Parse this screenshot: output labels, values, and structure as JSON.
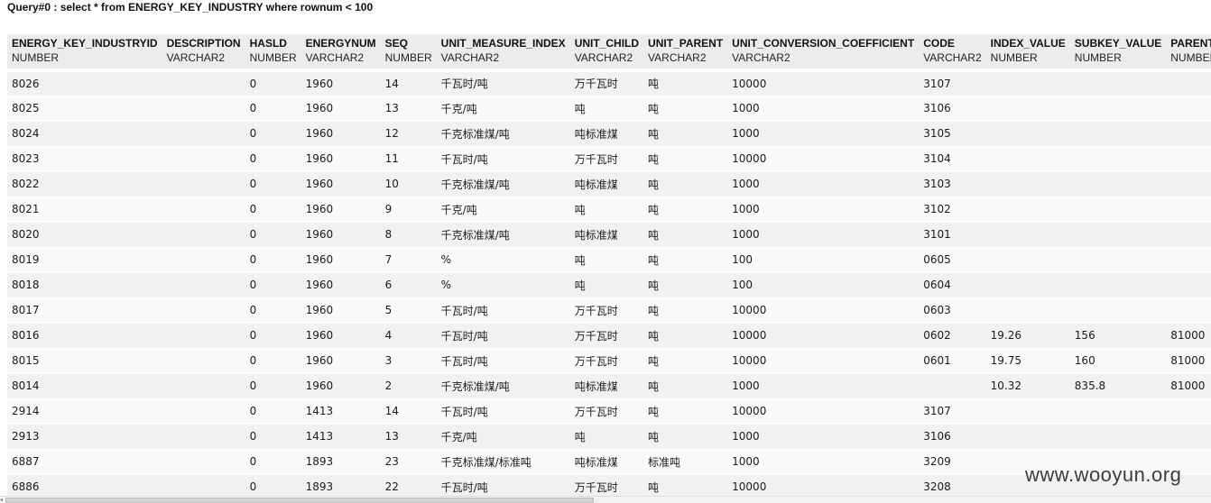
{
  "query_title": "Query#0 : select * from ENERGY_KEY_INDUSTRY where rownum < 100",
  "columns": [
    {
      "name": "ENERGY_KEY_INDUSTRYID",
      "type": "NUMBER"
    },
    {
      "name": "DESCRIPTION",
      "type": "VARCHAR2"
    },
    {
      "name": "HASLD",
      "type": "NUMBER"
    },
    {
      "name": "ENERGYNUM",
      "type": "VARCHAR2"
    },
    {
      "name": "SEQ",
      "type": "NUMBER"
    },
    {
      "name": "UNIT_MEASURE_INDEX",
      "type": "VARCHAR2"
    },
    {
      "name": "UNIT_CHILD",
      "type": "VARCHAR2"
    },
    {
      "name": "UNIT_PARENT",
      "type": "VARCHAR2"
    },
    {
      "name": "UNIT_CONVERSION_COEFFICIENT",
      "type": "VARCHAR2"
    },
    {
      "name": "CODE",
      "type": "VARCHAR2"
    },
    {
      "name": "INDEX_VALUE",
      "type": "NUMBER"
    },
    {
      "name": "SUBKEY_VALUE",
      "type": "NUMBER"
    },
    {
      "name": "PARENT_",
      "type": "NUMBER"
    }
  ],
  "rows": [
    [
      "8026",
      "",
      "0",
      "1960",
      "14",
      "千瓦时/吨",
      "万千瓦时",
      "吨",
      "10000",
      "3107",
      "",
      "",
      ""
    ],
    [
      "8025",
      "",
      "0",
      "1960",
      "13",
      "千克/吨",
      "吨",
      "吨",
      "1000",
      "3106",
      "",
      "",
      ""
    ],
    [
      "8024",
      "",
      "0",
      "1960",
      "12",
      "千克标准煤/吨",
      "吨标准煤",
      "吨",
      "1000",
      "3105",
      "",
      "",
      ""
    ],
    [
      "8023",
      "",
      "0",
      "1960",
      "11",
      "千瓦时/吨",
      "万千瓦时",
      "吨",
      "10000",
      "3104",
      "",
      "",
      ""
    ],
    [
      "8022",
      "",
      "0",
      "1960",
      "10",
      "千克标准煤/吨",
      "吨标准煤",
      "吨",
      "1000",
      "3103",
      "",
      "",
      ""
    ],
    [
      "8021",
      "",
      "0",
      "1960",
      "9",
      "千克/吨",
      "吨",
      "吨",
      "1000",
      "3102",
      "",
      "",
      ""
    ],
    [
      "8020",
      "",
      "0",
      "1960",
      "8",
      "千克标准煤/吨",
      "吨标准煤",
      "吨",
      "1000",
      "3101",
      "",
      "",
      ""
    ],
    [
      "8019",
      "",
      "0",
      "1960",
      "7",
      "%",
      "吨",
      "吨",
      "100",
      "0605",
      "",
      "",
      ""
    ],
    [
      "8018",
      "",
      "0",
      "1960",
      "6",
      "%",
      "吨",
      "吨",
      "100",
      "0604",
      "",
      "",
      ""
    ],
    [
      "8017",
      "",
      "0",
      "1960",
      "5",
      "千瓦时/吨",
      "万千瓦时",
      "吨",
      "10000",
      "0603",
      "",
      "",
      ""
    ],
    [
      "8016",
      "",
      "0",
      "1960",
      "4",
      "千瓦时/吨",
      "万千瓦时",
      "吨",
      "10000",
      "0602",
      "19.26",
      "156",
      "81000"
    ],
    [
      "8015",
      "",
      "0",
      "1960",
      "3",
      "千瓦时/吨",
      "万千瓦时",
      "吨",
      "10000",
      "0601",
      "19.75",
      "160",
      "81000"
    ],
    [
      "8014",
      "",
      "0",
      "1960",
      "2",
      "千克标准煤/吨",
      "吨标准煤",
      "吨",
      "1000",
      "",
      "10.32",
      "835.8",
      "81000"
    ],
    [
      "2914",
      "",
      "0",
      "1413",
      "14",
      "千瓦时/吨",
      "万千瓦时",
      "吨",
      "10000",
      "3107",
      "",
      "",
      ""
    ],
    [
      "2913",
      "",
      "0",
      "1413",
      "13",
      "千克/吨",
      "吨",
      "吨",
      "1000",
      "3106",
      "",
      "",
      ""
    ],
    [
      "6887",
      "",
      "0",
      "1893",
      "23",
      "千克标准煤/标准吨",
      "吨标准煤",
      "标准吨",
      "1000",
      "3209",
      "",
      "",
      ""
    ],
    [
      "6886",
      "",
      "0",
      "1893",
      "22",
      "千瓦时/吨",
      "万千瓦时",
      "吨",
      "10000",
      "3208",
      "",
      "",
      ""
    ]
  ],
  "watermark": "www.wooyun.org"
}
